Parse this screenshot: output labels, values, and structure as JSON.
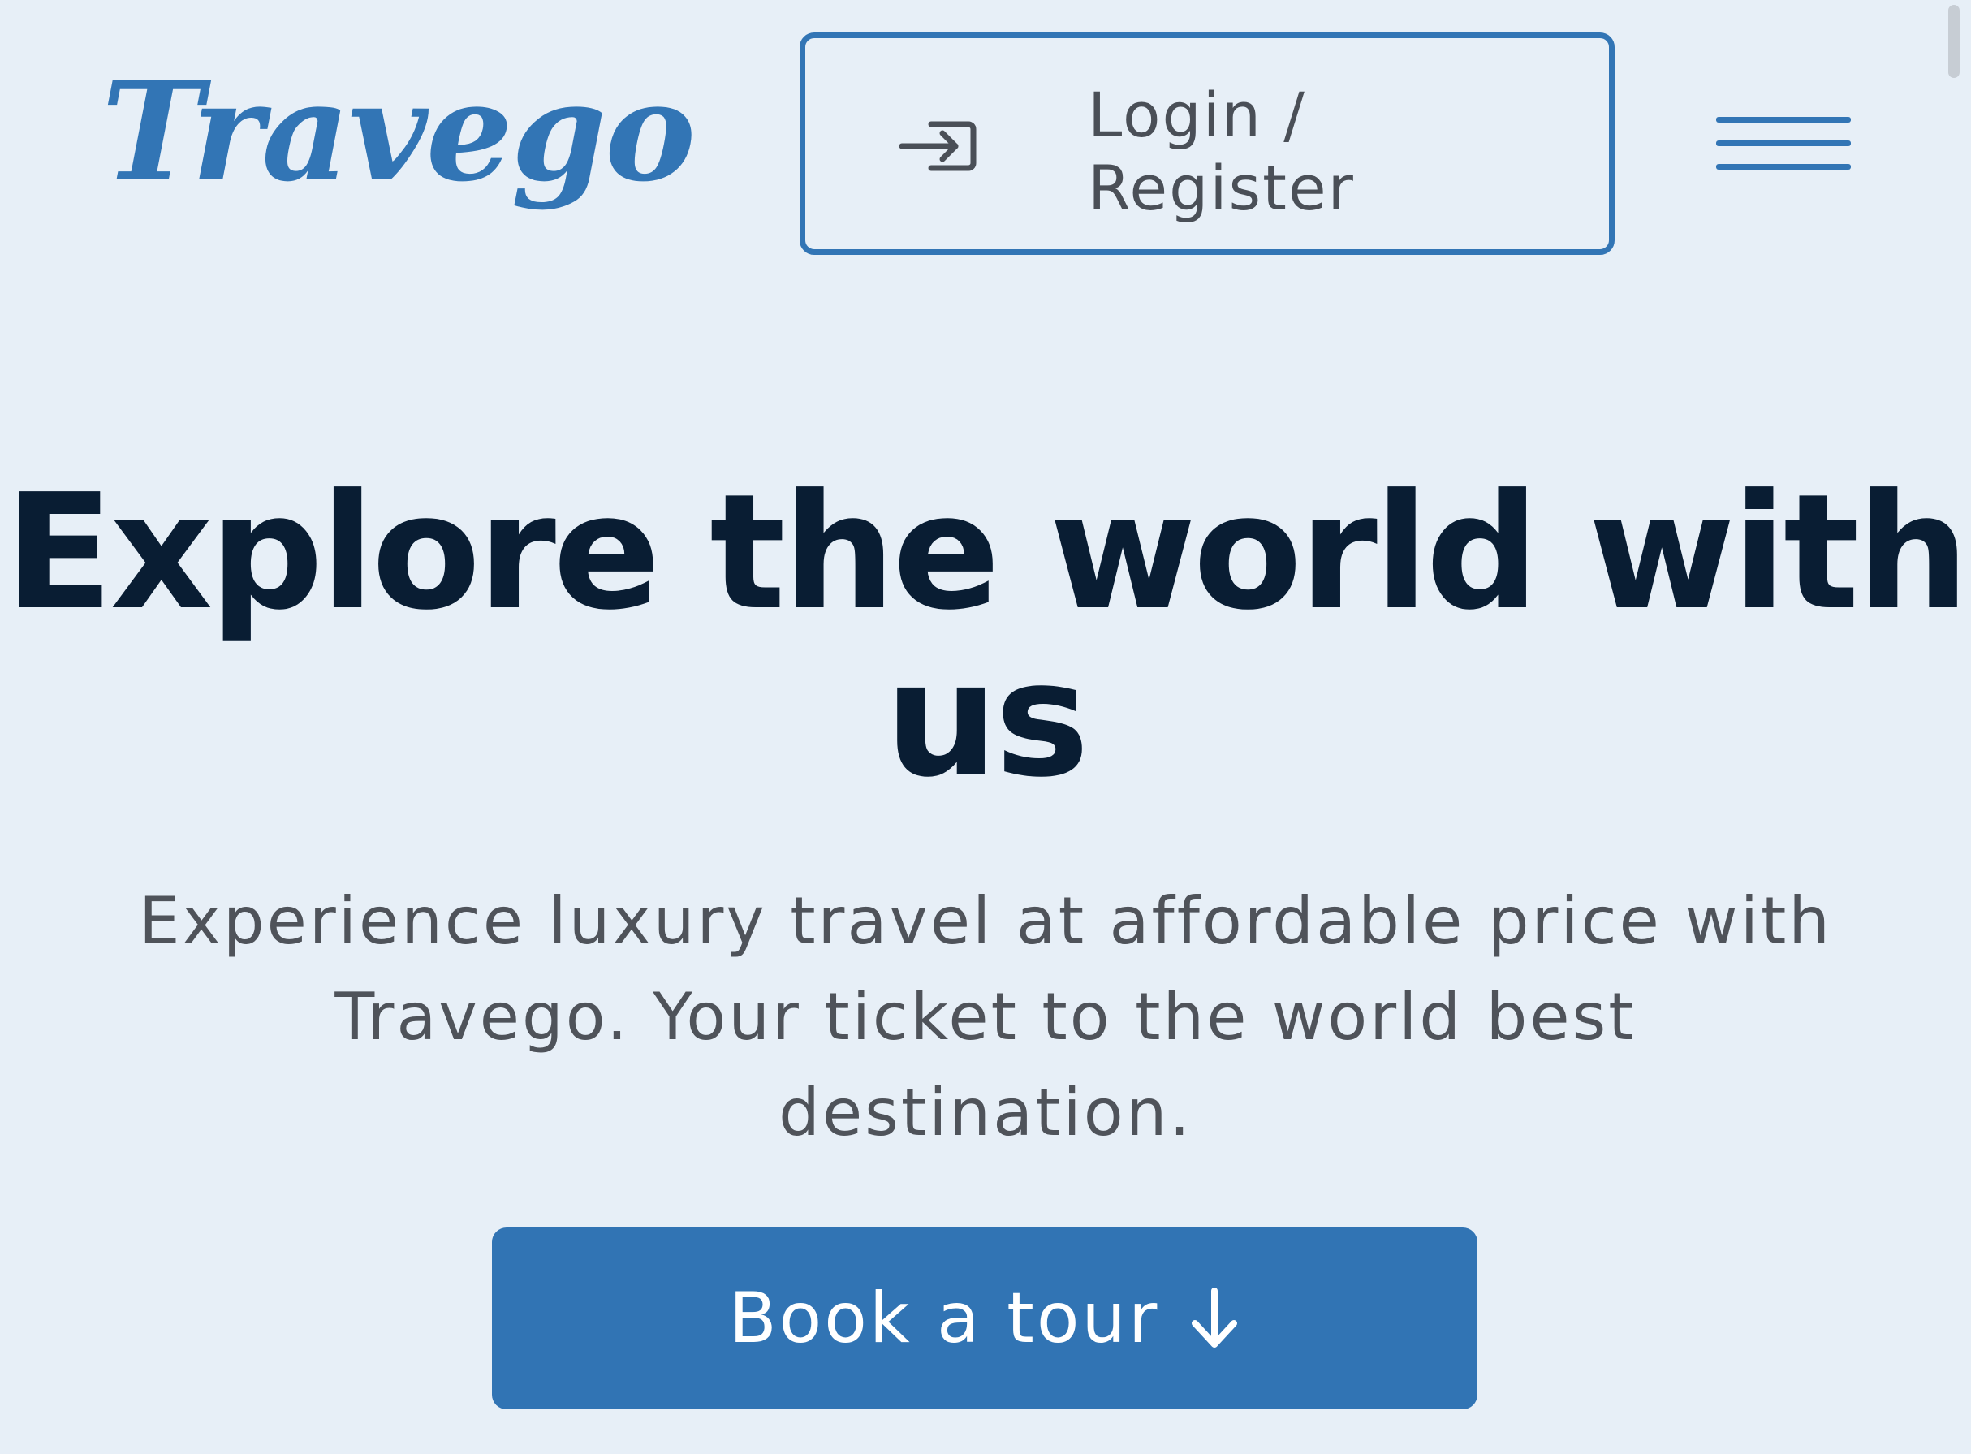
{
  "header": {
    "logo_text": "Travego",
    "login_label": "Login / Register",
    "login_icon": "login-icon",
    "menu_icon": "hamburger-menu-icon"
  },
  "hero": {
    "title": "Explore the world with us",
    "description": "Experience luxury travel at affordable price with Travego. Your ticket to the world best destination.",
    "cta_label": "Book a tour",
    "cta_icon": "arrow-down-icon"
  },
  "colors": {
    "background": "#e7eff7",
    "brand_blue": "#3275b5",
    "heading": "#091d33",
    "body_text": "#4f535a",
    "button_text": "#ffffff"
  }
}
